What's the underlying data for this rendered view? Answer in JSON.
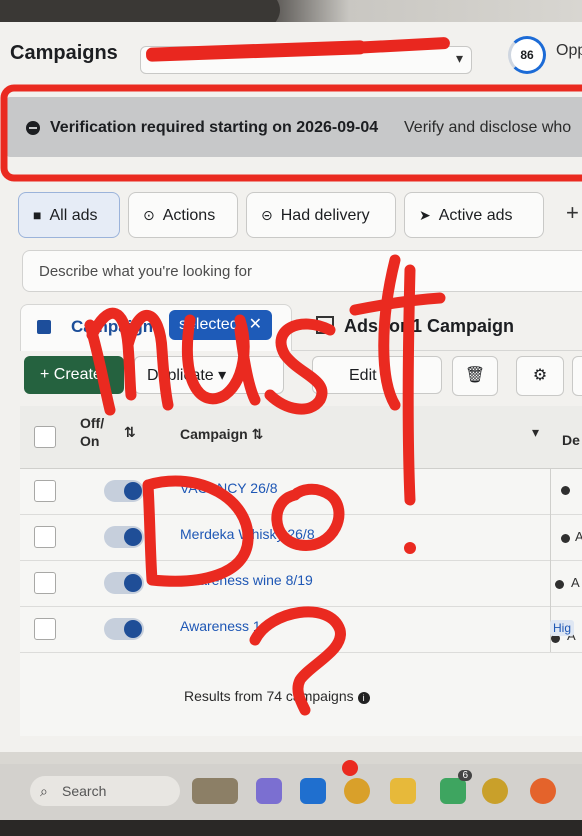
{
  "header": {
    "title": "Campaigns",
    "score": "86",
    "opp_label": "Opp"
  },
  "banner": {
    "title": "Verification required starting on 2026-09-04",
    "subtitle": "Verify and disclose who"
  },
  "filters": [
    {
      "label": "All ads",
      "icon": "folder-icon"
    },
    {
      "label": "Actions",
      "icon": "action-icon"
    },
    {
      "label": "Had delivery",
      "icon": "delivery-icon"
    },
    {
      "label": "Active ads",
      "icon": "send-icon"
    }
  ],
  "search": {
    "placeholder": "Describe what you're looking for"
  },
  "tabs": {
    "campaigns": "Campaigns",
    "selected": "selected",
    "ads": "Ads for 1 Campaign"
  },
  "toolbar": {
    "create": "Create",
    "duplicate": "Duplicate",
    "edit": "Edit"
  },
  "table": {
    "headers": {
      "offon": "Off/\nOn",
      "campaign": "Campaign",
      "delivery": "De"
    },
    "rows": [
      {
        "name": "VACANCY 26/8",
        "delivery": ""
      },
      {
        "name": "Merdeka Whisky 26/8",
        "delivery": "A"
      },
      {
        "name": "Awareness wine 8/19",
        "delivery": "A"
      },
      {
        "name": "Awareness 1",
        "delivery": "A"
      }
    ],
    "high_label": "Hig",
    "results": "Results from 74 campaigns"
  },
  "taskbar": {
    "search": "Search",
    "badge": "6"
  },
  "overlay_text": "Must Do! ?"
}
